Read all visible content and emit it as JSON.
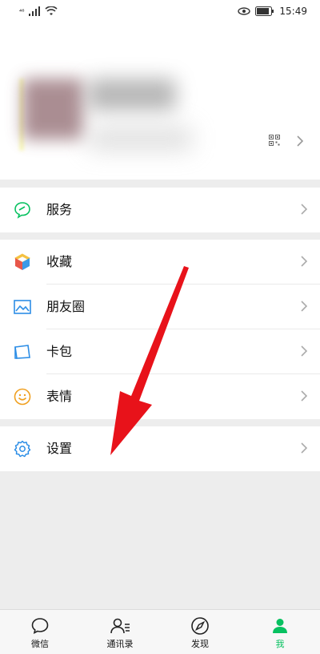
{
  "status_bar": {
    "signal": "⁴⁶",
    "time": "15:49"
  },
  "menu": {
    "service": {
      "label": "服务"
    },
    "items": [
      {
        "label": "收藏"
      },
      {
        "label": "朋友圈"
      },
      {
        "label": "卡包"
      },
      {
        "label": "表情"
      }
    ],
    "settings": {
      "label": "设置"
    }
  },
  "tabbar": {
    "tabs": [
      {
        "label": "微信"
      },
      {
        "label": "通讯录"
      },
      {
        "label": "发现"
      },
      {
        "label": "我"
      }
    ]
  },
  "colors": {
    "accent": "#07c160",
    "arrow": "#e8121a"
  }
}
